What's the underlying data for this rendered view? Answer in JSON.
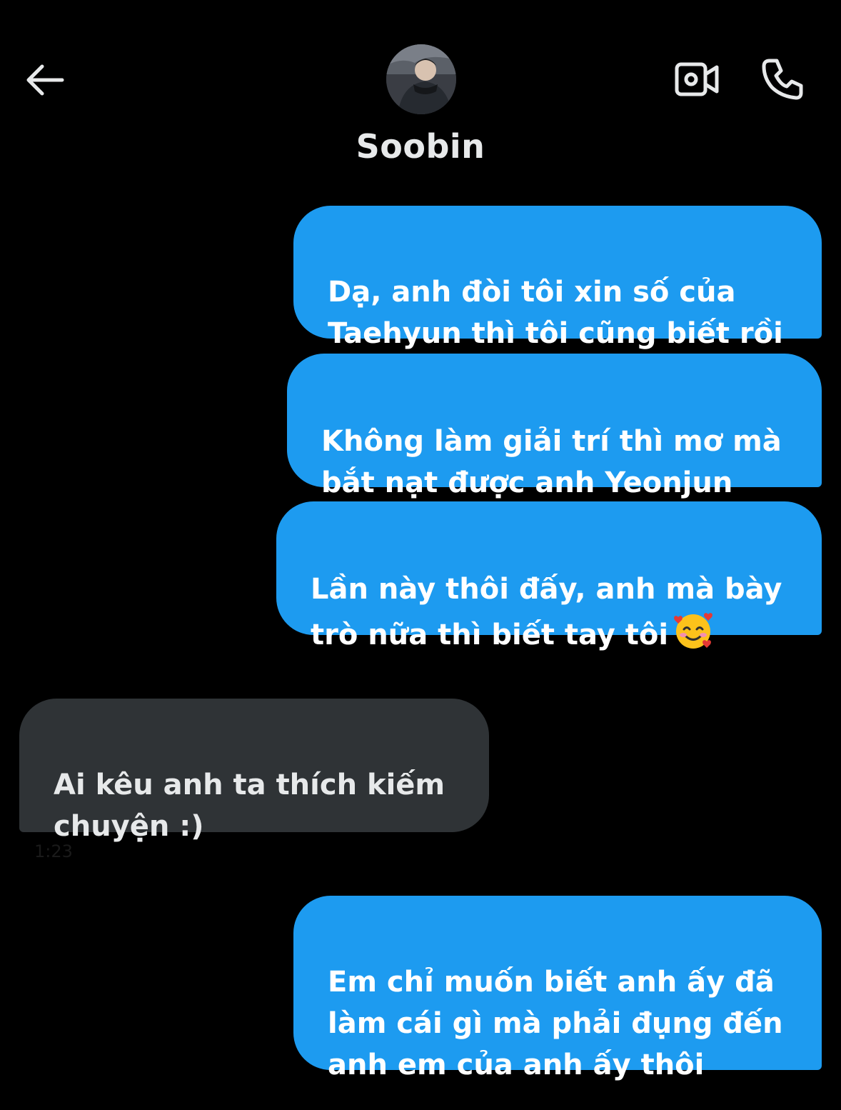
{
  "header": {
    "contact_name": "Soobin",
    "back_icon": "arrow-left-icon",
    "video_icon": "video-camera-icon",
    "call_icon": "phone-icon"
  },
  "colors": {
    "background": "#000000",
    "sent_bubble": "#1d9bf0",
    "received_bubble": "#2f3336"
  },
  "messages": [
    {
      "direction": "sent",
      "text": "Dạ, anh đòi tôi xin số của\nTaehyun thì tôi cũng biết rồi"
    },
    {
      "direction": "sent",
      "text": "Không làm giải trí thì mơ mà\nbắt nạt được anh Yeonjun"
    },
    {
      "direction": "sent",
      "text": "Lần này thôi đấy, anh mà bày\ntrò nữa thì biết tay tôi",
      "emoji": "smiling-face-with-hearts-icon"
    },
    {
      "direction": "received",
      "text": "Ai kêu anh ta thích kiếm\nchuyện :)"
    },
    {
      "direction": "sent",
      "text": "Em chỉ muốn biết anh ấy đã\nlàm cái gì mà phải đụng đến\nanh em của anh ấy thôi"
    }
  ],
  "received_time": "1:23"
}
